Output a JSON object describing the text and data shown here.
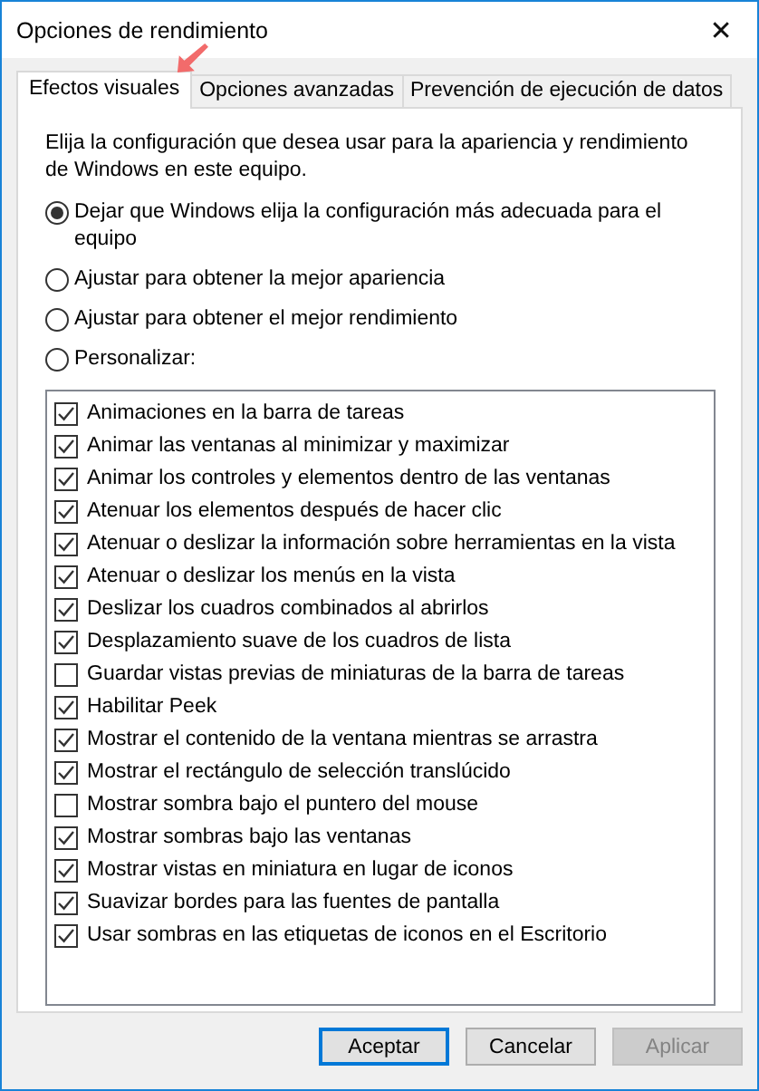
{
  "window": {
    "title": "Opciones de rendimiento",
    "close": "✕"
  },
  "tabs": [
    {
      "label": "Efectos visuales",
      "selected": true
    },
    {
      "label": "Opciones avanzadas",
      "selected": false
    },
    {
      "label": "Prevención de ejecución de datos",
      "selected": false
    }
  ],
  "description": "Elija la configuración que desea usar para la apariencia y rendimiento de Windows en este equipo.",
  "radios": [
    {
      "label": "Dejar que Windows elija la configuración más adecuada para el equipo",
      "selected": true
    },
    {
      "label": "Ajustar para obtener la mejor apariencia",
      "selected": false
    },
    {
      "label": "Ajustar para obtener el mejor rendimiento",
      "selected": false
    },
    {
      "label": "Personalizar:",
      "selected": false
    }
  ],
  "effects": [
    {
      "label": "Animaciones en la barra de tareas",
      "checked": true
    },
    {
      "label": "Animar las ventanas al minimizar y maximizar",
      "checked": true
    },
    {
      "label": "Animar los controles y elementos dentro de las ventanas",
      "checked": true
    },
    {
      "label": "Atenuar los elementos después de hacer clic",
      "checked": true
    },
    {
      "label": "Atenuar o deslizar la información sobre herramientas en la vista",
      "checked": true
    },
    {
      "label": "Atenuar o deslizar los menús en la vista",
      "checked": true
    },
    {
      "label": "Deslizar los cuadros combinados al abrirlos",
      "checked": true
    },
    {
      "label": "Desplazamiento suave de los cuadros de lista",
      "checked": true
    },
    {
      "label": "Guardar vistas previas de miniaturas de la barra de tareas",
      "checked": false
    },
    {
      "label": "Habilitar Peek",
      "checked": true
    },
    {
      "label": "Mostrar el contenido de la ventana mientras se arrastra",
      "checked": true
    },
    {
      "label": "Mostrar el rectángulo de selección translúcido",
      "checked": true
    },
    {
      "label": "Mostrar sombra bajo el puntero del mouse",
      "checked": false
    },
    {
      "label": "Mostrar sombras bajo las ventanas",
      "checked": true
    },
    {
      "label": "Mostrar vistas en miniatura en lugar de iconos",
      "checked": true
    },
    {
      "label": "Suavizar bordes para las fuentes de pantalla",
      "checked": true
    },
    {
      "label": "Usar sombras en las etiquetas de iconos en el Escritorio",
      "checked": true
    }
  ],
  "buttons": [
    {
      "label": "Aceptar",
      "default": true,
      "disabled": false
    },
    {
      "label": "Cancelar",
      "default": false,
      "disabled": false
    },
    {
      "label": "Aplicar",
      "default": false,
      "disabled": true
    }
  ]
}
